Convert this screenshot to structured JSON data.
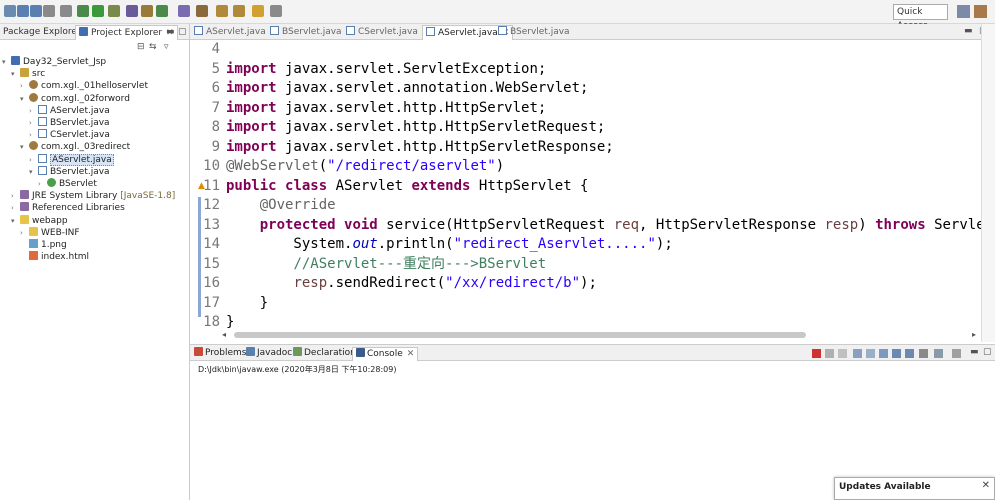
{
  "toolbar": {
    "quick_access": "Quick Access",
    "icons": [
      "new-file",
      "save",
      "save-all",
      "print",
      "undo",
      "debug",
      "run",
      "run-external",
      "new-java-project",
      "new-package",
      "new-class",
      "open-type",
      "search",
      "next-annotation",
      "prev-annotation",
      "back",
      "forward"
    ]
  },
  "left_panel": {
    "tabs": [
      {
        "label": "Package Explorer",
        "active": false
      },
      {
        "label": "Project Explorer",
        "active": true
      }
    ],
    "tree": [
      {
        "label": "Day32_Servlet_Jsp",
        "icon": "project-icon",
        "depth": 0,
        "expander": "open"
      },
      {
        "label": "src",
        "icon": "source-folder-icon",
        "depth": 1,
        "expander": "open"
      },
      {
        "label": "com.xgl._01helloservlet",
        "icon": "package-icon",
        "depth": 2,
        "expander": "closed"
      },
      {
        "label": "com.xgl._02forword",
        "icon": "package-icon",
        "depth": 2,
        "expander": "open"
      },
      {
        "label": "AServlet.java",
        "icon": "java-file-icon",
        "depth": 3,
        "expander": "closed"
      },
      {
        "label": "BServlet.java",
        "icon": "java-file-icon",
        "depth": 3,
        "expander": "closed"
      },
      {
        "label": "CServlet.java",
        "icon": "java-file-icon",
        "depth": 3,
        "expander": "closed"
      },
      {
        "label": "com.xgl._03redirect",
        "icon": "package-icon",
        "depth": 2,
        "expander": "open"
      },
      {
        "label": "AServlet.java",
        "icon": "java-file-icon",
        "depth": 3,
        "expander": "closed",
        "selected": true
      },
      {
        "label": "BServlet.java",
        "icon": "java-file-icon",
        "depth": 3,
        "expander": "open"
      },
      {
        "label": "BServlet",
        "icon": "class-icon",
        "depth": 4,
        "expander": "closed"
      },
      {
        "label": "JRE System Library",
        "suffix": "[JavaSE-1.8]",
        "icon": "library-icon",
        "depth": 1,
        "expander": "closed"
      },
      {
        "label": "Referenced Libraries",
        "icon": "library-icon",
        "depth": 1,
        "expander": "closed"
      },
      {
        "label": "webapp",
        "icon": "folder-icon",
        "depth": 1,
        "expander": "open"
      },
      {
        "label": "WEB-INF",
        "icon": "folder-icon",
        "depth": 2,
        "expander": "closed"
      },
      {
        "label": "1.png",
        "icon": "image-file-icon",
        "depth": 2,
        "expander": "none"
      },
      {
        "label": "index.html",
        "icon": "html-file-icon",
        "depth": 2,
        "expander": "none"
      }
    ]
  },
  "editor": {
    "tabs": [
      {
        "label": "AServlet.java",
        "active": false
      },
      {
        "label": "BServlet.java",
        "active": false
      },
      {
        "label": "CServlet.java",
        "active": false
      },
      {
        "label": "AServlet.java",
        "active": true
      },
      {
        "label": "BServlet.java",
        "active": false
      }
    ],
    "lines": [
      {
        "num": "4",
        "parts": []
      },
      {
        "num": "5",
        "parts": [
          {
            "t": "import",
            "c": "kw"
          },
          {
            "t": " javax.servlet.ServletException;"
          }
        ]
      },
      {
        "num": "6",
        "parts": [
          {
            "t": "import",
            "c": "kw"
          },
          {
            "t": " javax.servlet.annotation.WebServlet;"
          }
        ]
      },
      {
        "num": "7",
        "parts": [
          {
            "t": "import",
            "c": "kw"
          },
          {
            "t": " javax.servlet.http.HttpServlet;"
          }
        ]
      },
      {
        "num": "8",
        "parts": [
          {
            "t": "import",
            "c": "kw"
          },
          {
            "t": " javax.servlet.http.HttpServletRequest;"
          }
        ]
      },
      {
        "num": "9",
        "parts": [
          {
            "t": "import",
            "c": "kw"
          },
          {
            "t": " javax.servlet.http.HttpServletResponse;"
          }
        ]
      },
      {
        "num": "10",
        "parts": [
          {
            "t": "@WebServlet",
            "c": "ann"
          },
          {
            "t": "("
          },
          {
            "t": "\"/redirect/aservlet\"",
            "c": "str"
          },
          {
            "t": ")"
          }
        ]
      },
      {
        "num": "11",
        "parts": [
          {
            "t": "public",
            "c": "kw"
          },
          {
            "t": " "
          },
          {
            "t": "class",
            "c": "kw"
          },
          {
            "t": " AServlet "
          },
          {
            "t": "extends",
            "c": "kw"
          },
          {
            "t": " HttpServlet {"
          }
        ],
        "warning": true
      },
      {
        "num": "12",
        "parts": [
          {
            "t": "    "
          },
          {
            "t": "@Override",
            "c": "ann"
          }
        ]
      },
      {
        "num": "13",
        "parts": [
          {
            "t": "    "
          },
          {
            "t": "protected",
            "c": "kw"
          },
          {
            "t": " "
          },
          {
            "t": "void",
            "c": "kw"
          },
          {
            "t": " service(HttpServletRequest "
          },
          {
            "t": "req",
            "c": "param"
          },
          {
            "t": ", HttpServletResponse "
          },
          {
            "t": "resp",
            "c": "param"
          },
          {
            "t": ") "
          },
          {
            "t": "throws",
            "c": "kw"
          },
          {
            "t": " Servle"
          }
        ]
      },
      {
        "num": "14",
        "parts": [
          {
            "t": "        System."
          },
          {
            "t": "out",
            "c": "field"
          },
          {
            "t": ".println("
          },
          {
            "t": "\"redirect_Aservlet.....\"",
            "c": "str"
          },
          {
            "t": ");"
          }
        ]
      },
      {
        "num": "15",
        "parts": [
          {
            "t": "        "
          },
          {
            "t": "//AServlet---重定向--->BServlet",
            "c": "cmt"
          }
        ]
      },
      {
        "num": "16",
        "parts": [
          {
            "t": "        "
          },
          {
            "t": "resp",
            "c": "param"
          },
          {
            "t": ".sendRedirect("
          },
          {
            "t": "\"/xx/redirect/b\"",
            "c": "str"
          },
          {
            "t": ");"
          }
        ]
      },
      {
        "num": "17",
        "parts": [
          {
            "t": "    }"
          }
        ]
      },
      {
        "num": "18",
        "parts": [
          {
            "t": "}"
          }
        ]
      }
    ]
  },
  "console_panel": {
    "tabs": [
      {
        "label": "Problems",
        "icon_color": "#c84a3a",
        "active": false
      },
      {
        "label": "Javadoc",
        "icon_color": "#5a7fb0",
        "active": false
      },
      {
        "label": "Declaration",
        "icon_color": "#6a9a5a",
        "active": false
      },
      {
        "label": "Console",
        "icon_color": "#3a5a8a",
        "active": true
      }
    ],
    "output": "D:\\Jdk\\bin\\javaw.exe (2020年3月8日 下午10:28:09)"
  },
  "updates": {
    "title": "Updates Available"
  },
  "colors": {
    "keyword": "#7f0055",
    "string": "#2a00ff",
    "comment": "#3f7f5f",
    "annotation": "#646464",
    "selection": "#d6e4f5"
  }
}
